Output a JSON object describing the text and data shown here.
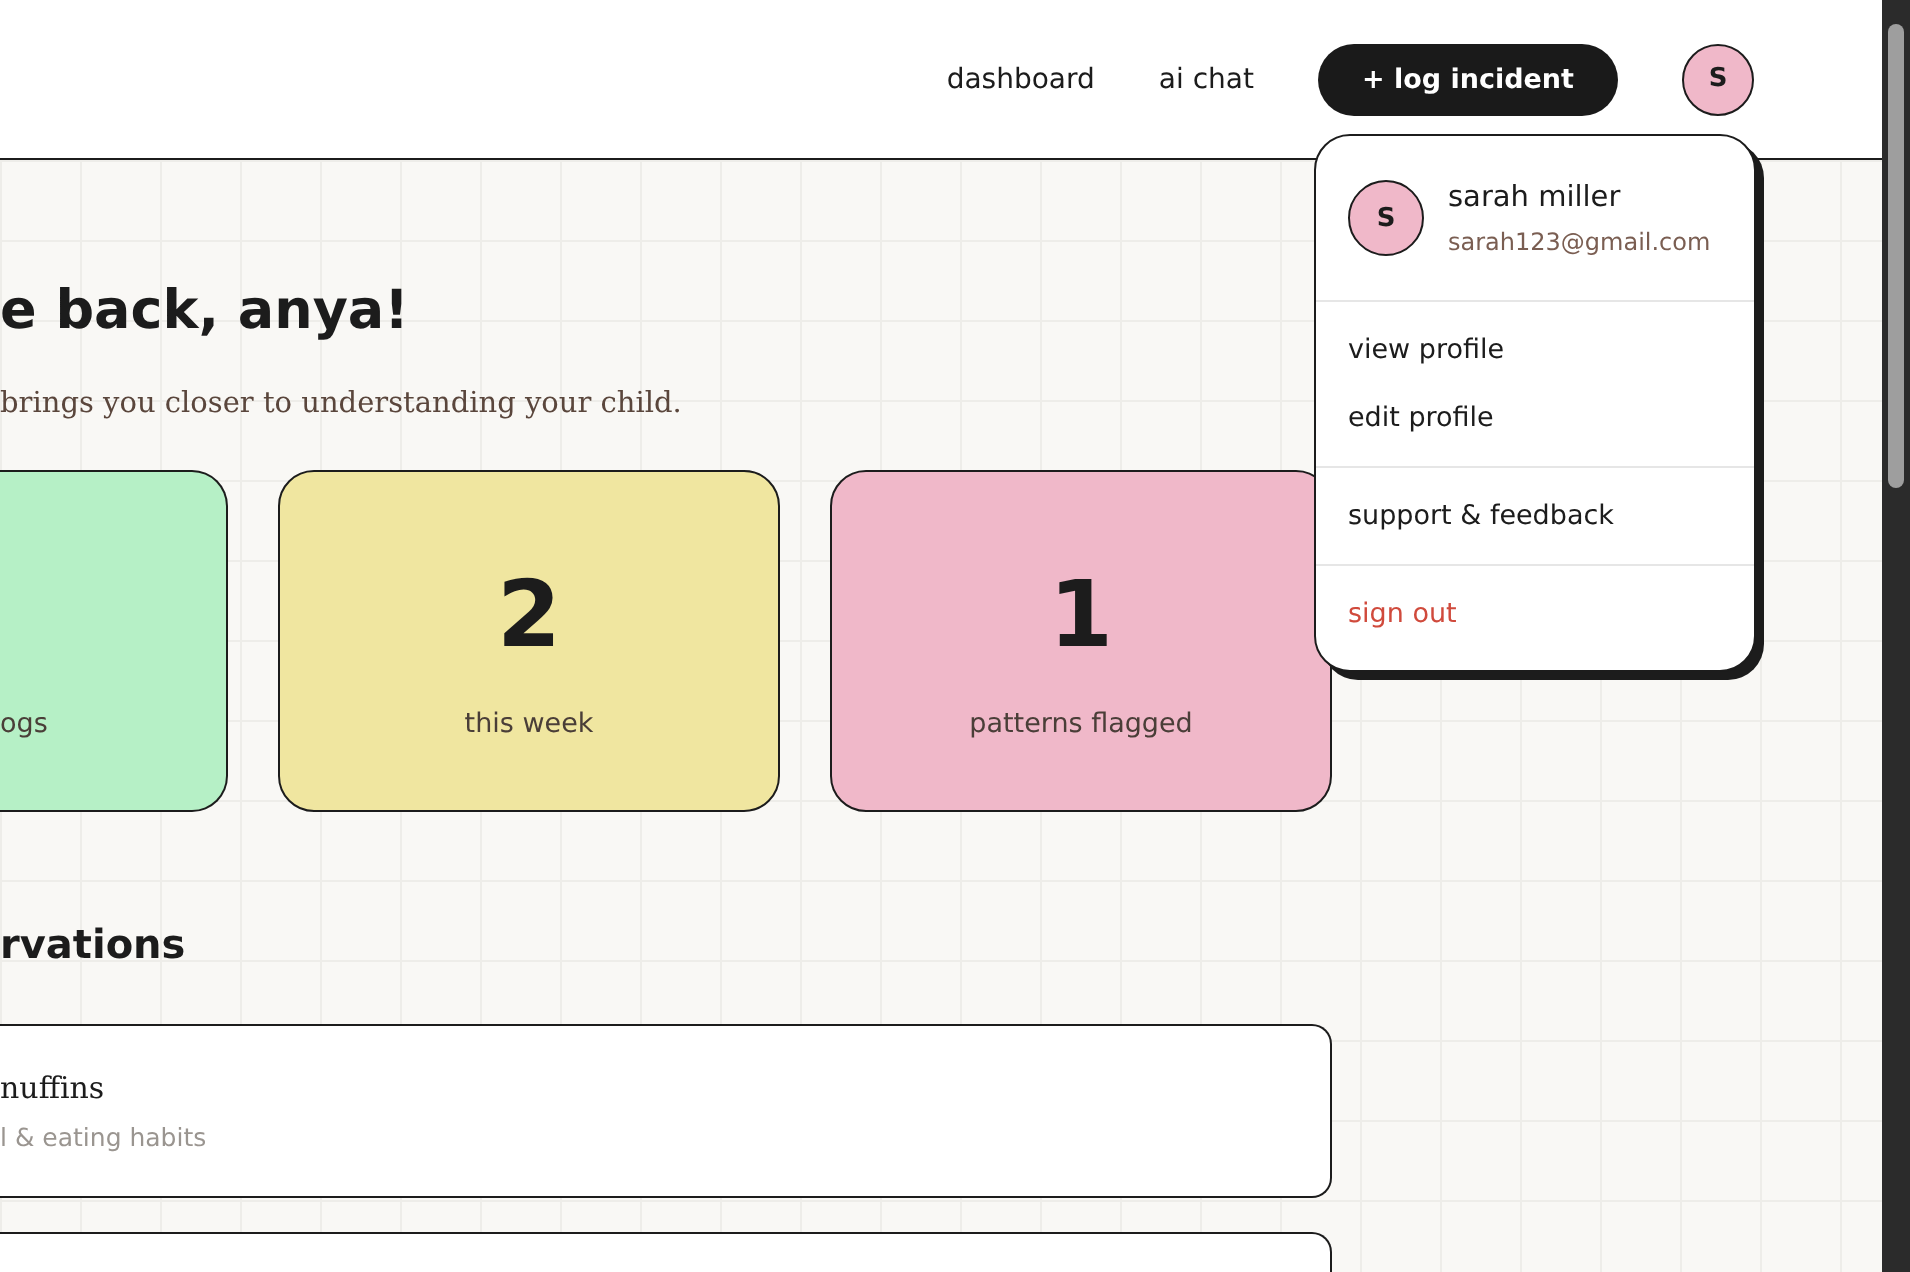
{
  "header": {
    "nav": [
      {
        "label": "dashboard"
      },
      {
        "label": "ai chat"
      }
    ],
    "action_button": "+ log incident",
    "avatar_initial": "S"
  },
  "welcome": {
    "title": "e back, anya!",
    "subtitle": "brings you closer to understanding your child."
  },
  "stats": [
    {
      "label": "ogs",
      "color": "#b6f0c6"
    },
    {
      "value": "2",
      "label": "this week",
      "color": "#f0e6a0"
    },
    {
      "value": "1",
      "label": "patterns flagged",
      "color": "#f0b8c9"
    }
  ],
  "observations": {
    "title": "rvations",
    "items": [
      {
        "title": "nuffins",
        "tags": "l & eating habits"
      }
    ]
  },
  "user_menu": {
    "avatar_initial": "S",
    "name": "sarah miller",
    "email": "sarah123@gmail.com",
    "sections": [
      [
        {
          "label": "view profile",
          "kind": "normal"
        },
        {
          "label": "edit profile",
          "kind": "normal"
        }
      ],
      [
        {
          "label": "support & feedback",
          "kind": "normal"
        }
      ],
      [
        {
          "label": "sign out",
          "kind": "danger"
        }
      ]
    ]
  }
}
